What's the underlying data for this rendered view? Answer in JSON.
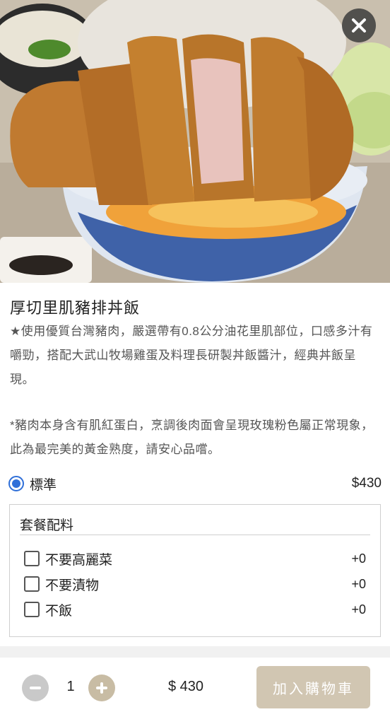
{
  "colors": {
    "accent_blue": "#2f6fd8",
    "cart_button": "#d1c6b2",
    "plus_button": "#c8bca4",
    "minus_button": "#c9c9c9"
  },
  "product": {
    "title": "厚切里肌豬排丼飯",
    "description": "★使用優質台灣豬肉，嚴選帶有0.8公分油花里肌部位，口感多汁有嚼勁，搭配大武山牧場雞蛋及料理長研製丼飯醬汁，經典丼飯呈現。",
    "note": "*豬肉本身含有肌紅蛋白，烹調後肉面會呈現玫瑰粉色屬正常現象，此為最完美的黃金熟度，請安心品嚐。"
  },
  "size": {
    "label": "標準",
    "price": "$430",
    "selected": true
  },
  "options": {
    "title": "套餐配料",
    "items": [
      {
        "label": "不要高麗菜",
        "price": "+0"
      },
      {
        "label": "不要漬物",
        "price": "+0"
      },
      {
        "label": "不飯",
        "price": "+0"
      }
    ]
  },
  "footer": {
    "quantity": "1",
    "total": "$ 430",
    "add_to_cart": "加入購物車"
  },
  "icons": {
    "close": "close-icon",
    "minus": "minus-icon",
    "plus": "plus-icon"
  }
}
